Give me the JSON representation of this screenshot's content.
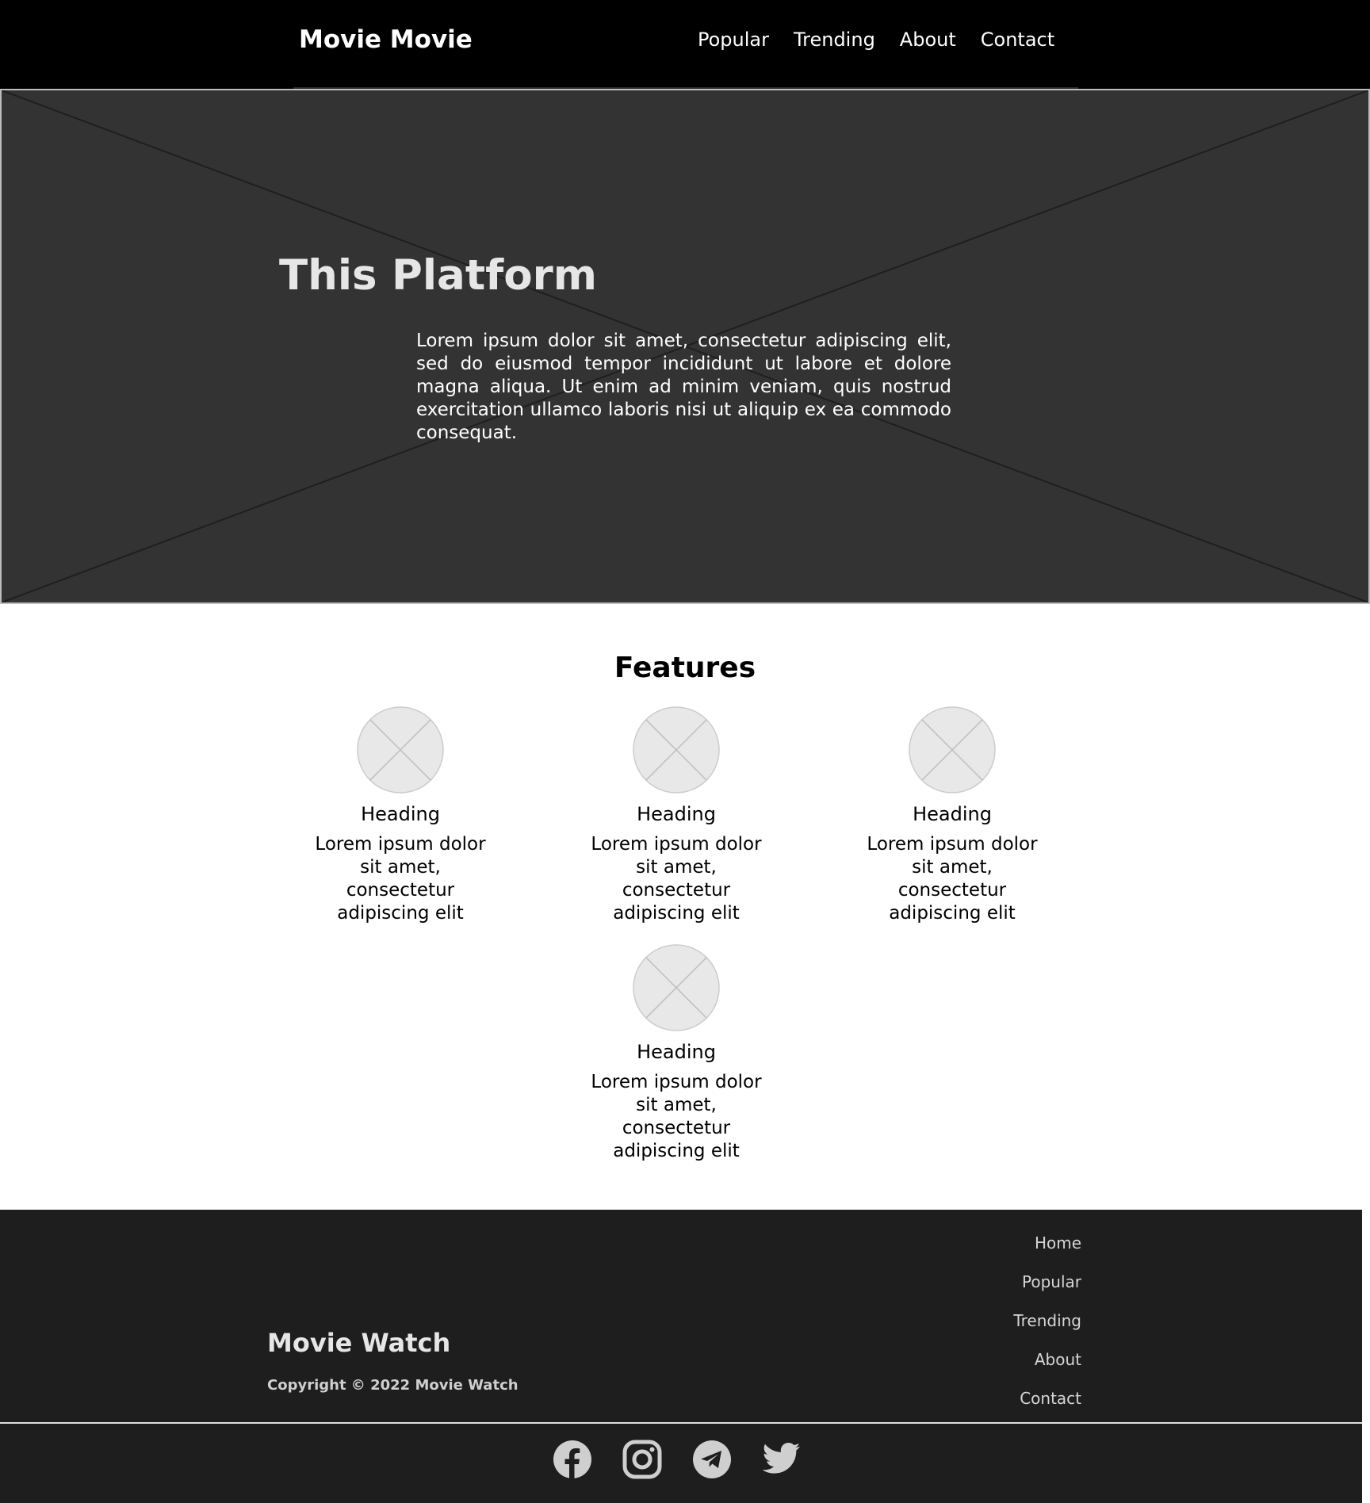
{
  "header": {
    "brand": "Movie Movie",
    "nav": [
      "Popular",
      "Trending",
      "About",
      "Contact"
    ]
  },
  "hero": {
    "title": "This Platform",
    "text": "Lorem ipsum dolor sit amet, consectetur adipiscing elit, sed do eiusmod tempor incididunt ut labore et dolore magna aliqua. Ut enim ad minim veniam, quis nostrud exercitation ullamco laboris nisi ut aliquip ex ea commodo consequat."
  },
  "features": {
    "title": "Features",
    "items": [
      {
        "heading": "Heading",
        "text": "Lorem ipsum dolor sit amet, consectetur adipiscing elit"
      },
      {
        "heading": "Heading",
        "text": "Lorem ipsum dolor sit amet, consectetur adipiscing elit"
      },
      {
        "heading": "Heading",
        "text": "Lorem ipsum dolor sit amet, consectetur adipiscing elit"
      },
      {
        "heading": "Heading",
        "text": "Lorem ipsum dolor sit amet, consectetur adipiscing elit"
      }
    ]
  },
  "footer": {
    "brand": "Movie Watch",
    "copyright": "Copyright © 2022 Movie Watch",
    "nav": [
      "Home",
      "Popular",
      "Trending",
      "About",
      "Contact"
    ],
    "social": [
      "facebook-icon",
      "instagram-icon",
      "telegram-icon",
      "twitter-icon"
    ]
  },
  "colors": {
    "header_bg": "#000000",
    "hero_bg": "#333333",
    "footer_bg": "#1e1e1e",
    "placeholder_circle": "#e8e8e8"
  }
}
